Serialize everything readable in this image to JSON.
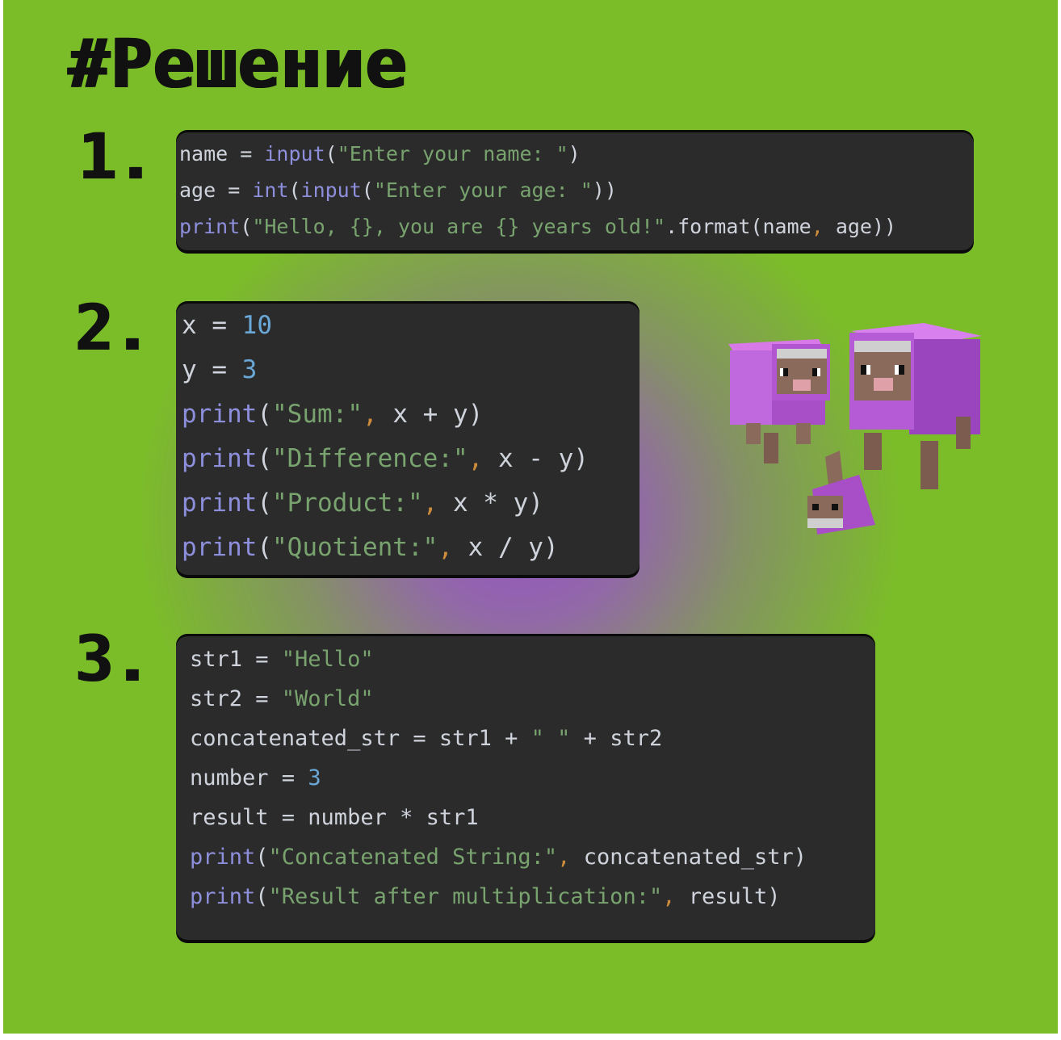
{
  "title": "#Решение",
  "steps": [
    {
      "number": "1.",
      "lines": [
        [
          [
            "v",
            "name = "
          ],
          [
            "kw",
            "input"
          ],
          [
            "v",
            "("
          ],
          [
            "st",
            "\"Enter your name: \""
          ],
          [
            "v",
            ")"
          ]
        ],
        [
          [
            "v",
            "age = "
          ],
          [
            "kw",
            "int"
          ],
          [
            "v",
            "("
          ],
          [
            "kw",
            "input"
          ],
          [
            "v",
            "("
          ],
          [
            "st",
            "\"Enter your age: \""
          ],
          [
            "v",
            "))"
          ]
        ],
        [
          [
            "kw",
            "print"
          ],
          [
            "v",
            "("
          ],
          [
            "st",
            "\"Hello, {}, you are {} years old!\""
          ],
          [
            "v",
            ".format(name"
          ],
          [
            "cm",
            ", "
          ],
          [
            "v",
            "age))"
          ]
        ]
      ]
    },
    {
      "number": "2.",
      "lines": [
        [
          [
            "v",
            "x = "
          ],
          [
            "nm",
            "10"
          ]
        ],
        [
          [
            "v",
            "y = "
          ],
          [
            "nm",
            "3"
          ]
        ],
        [
          [
            "kw",
            "print"
          ],
          [
            "v",
            "("
          ],
          [
            "st",
            "\"Sum:\""
          ],
          [
            "cm",
            ", "
          ],
          [
            "v",
            "x + y)"
          ]
        ],
        [
          [
            "kw",
            "print"
          ],
          [
            "v",
            "("
          ],
          [
            "st",
            "\"Difference:\""
          ],
          [
            "cm",
            ", "
          ],
          [
            "v",
            "x - y)"
          ]
        ],
        [
          [
            "kw",
            "print"
          ],
          [
            "v",
            "("
          ],
          [
            "st",
            "\"Product:\""
          ],
          [
            "cm",
            ", "
          ],
          [
            "v",
            "x * y)"
          ]
        ],
        [
          [
            "kw",
            "print"
          ],
          [
            "v",
            "("
          ],
          [
            "st",
            "\"Quotient:\""
          ],
          [
            "cm",
            ", "
          ],
          [
            "v",
            "x / y)"
          ]
        ]
      ]
    },
    {
      "number": "3.",
      "lines": [
        [
          [
            "v",
            "str1 = "
          ],
          [
            "st",
            "\"Hello\""
          ]
        ],
        [
          [
            "v",
            "str2 = "
          ],
          [
            "st",
            "\"World\""
          ]
        ],
        [
          [
            "v",
            "concatenated_str = str1 + "
          ],
          [
            "st",
            "\" \""
          ],
          [
            "v",
            " + str2"
          ]
        ],
        [
          [
            "v",
            "number = "
          ],
          [
            "nm",
            "3"
          ]
        ],
        [
          [
            "v",
            "result = number * str1"
          ]
        ],
        [
          [
            "kw",
            "print"
          ],
          [
            "v",
            "("
          ],
          [
            "st",
            "\"Concatenated String:\""
          ],
          [
            "cm",
            ", "
          ],
          [
            "v",
            "concatenated_str)"
          ]
        ],
        [
          [
            "kw",
            "print"
          ],
          [
            "v",
            "("
          ],
          [
            "st",
            "\"Result after multiplication:\""
          ],
          [
            "cm",
            ", "
          ],
          [
            "v",
            "result)"
          ]
        ]
      ]
    }
  ],
  "illustration": "purple-minecraft-sheep"
}
